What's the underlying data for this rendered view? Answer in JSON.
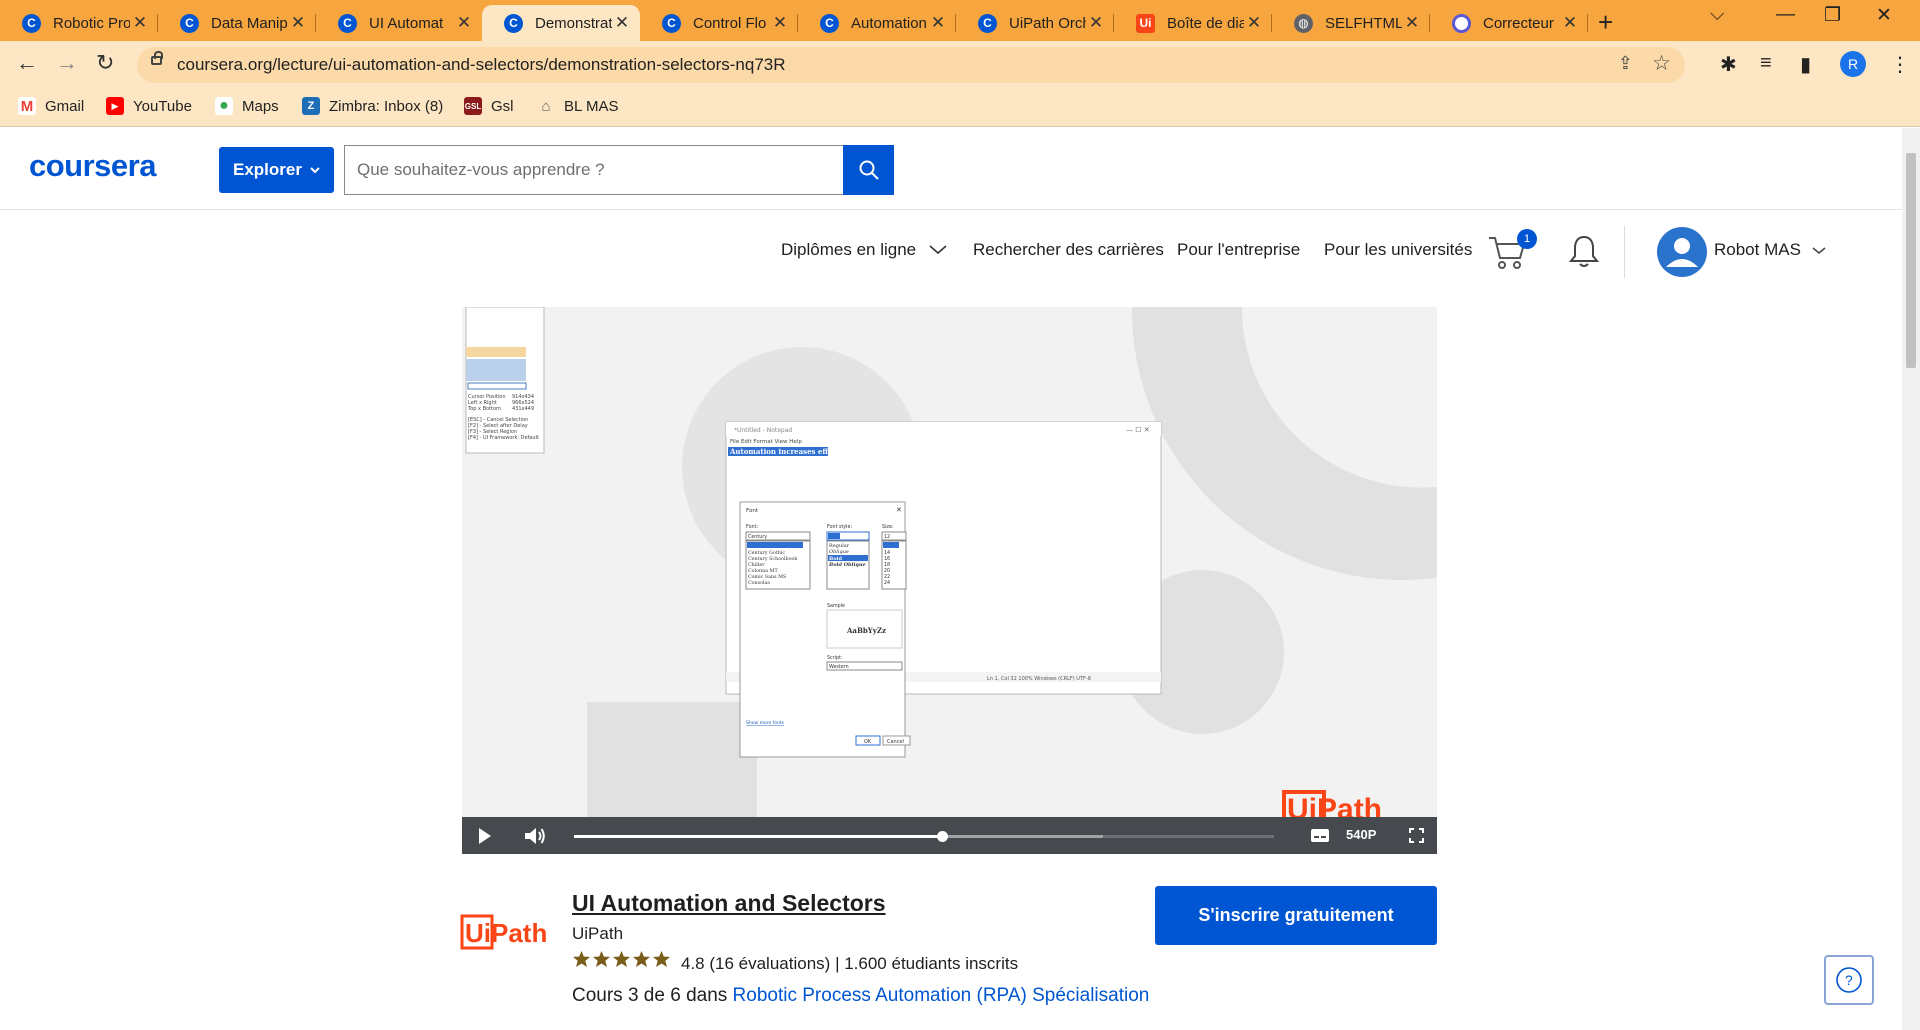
{
  "browser": {
    "tabs": [
      {
        "title": "Robotic Pro",
        "icon": "coursera-icon"
      },
      {
        "title": "Data Manip",
        "icon": "coursera-icon"
      },
      {
        "title": "UI Automat",
        "icon": "coursera-icon"
      },
      {
        "title": "Demonstrat",
        "icon": "coursera-icon",
        "active": true
      },
      {
        "title": "Control Flo",
        "icon": "coursera-icon"
      },
      {
        "title": "Automation",
        "icon": "coursera-icon"
      },
      {
        "title": "UiPath Orch",
        "icon": "coursera-icon"
      },
      {
        "title": "Boîte de dia",
        "icon": "uipath-icon"
      },
      {
        "title": "SELFHTML:",
        "icon": "globe-icon"
      },
      {
        "title": "Correcteur",
        "icon": "correcteur-icon"
      }
    ],
    "url": "coursera.org/lecture/ui-automation-and-selectors/demonstration-selectors-nq73R",
    "profile_initial": "R",
    "bookmarks": [
      {
        "label": "Gmail",
        "icon": "gmail-icon"
      },
      {
        "label": "YouTube",
        "icon": "youtube-icon"
      },
      {
        "label": "Maps",
        "icon": "maps-icon"
      },
      {
        "label": "Zimbra: Inbox (8)",
        "icon": "zimbra-icon"
      },
      {
        "label": "Gsl",
        "icon": "gsl-icon"
      },
      {
        "label": "BL MAS",
        "icon": "home-icon"
      }
    ]
  },
  "header": {
    "logo": "coursera",
    "explore_label": "Explorer",
    "search_placeholder": "Que souhaitez-vous apprendre ?",
    "nav": {
      "degrees": "Diplômes en ligne",
      "careers": "Rechercher des carrières",
      "business": "Pour l'entreprise",
      "universities": "Pour les universités"
    },
    "cart_count": "1",
    "user_name": "Robot MAS"
  },
  "video": {
    "quality": "540P",
    "progress_fraction": 0.525,
    "buffered_fraction": 0.755,
    "notepad_text": "Automation increases efficiency",
    "watermark": "UiPath"
  },
  "course": {
    "partner_logo": "UiPath",
    "title": "UI Automation and Selectors",
    "partner": "UiPath",
    "rating": 4.8,
    "rating_text": "4.8 (16 évaluations)",
    "separator": "|",
    "students_text": "1.600 étudiants inscrits",
    "index_prefix": "Cours 3 de 6 dans",
    "specialization": "Robotic Process Automation (RPA) Spécialisation",
    "enroll_label": "S'inscrire gratuitement"
  },
  "colors": {
    "brand_blue": "#0056d2",
    "tabbar_orange": "#f6a53f",
    "uipath_orange": "#fa4616"
  }
}
